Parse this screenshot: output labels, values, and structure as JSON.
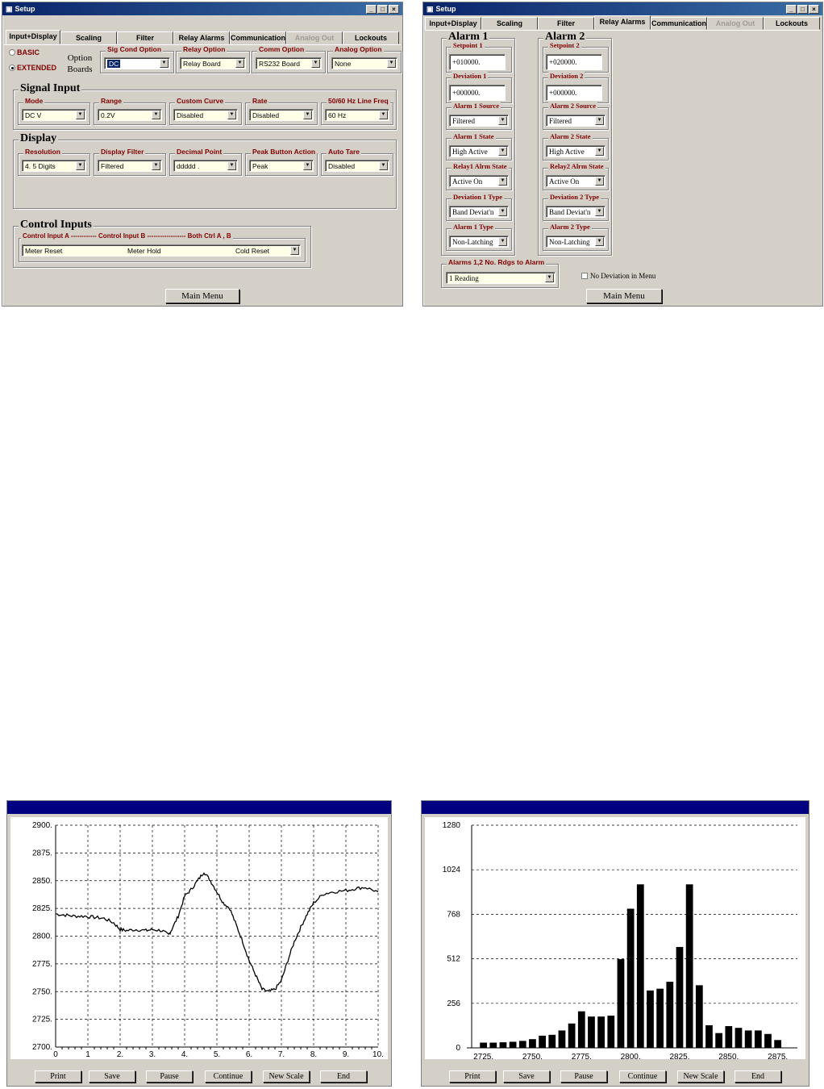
{
  "win1": {
    "title": "Setup",
    "tabs": [
      "Input+Display",
      "Scaling",
      "Filter",
      "Relay Alarms",
      "Communication",
      "Analog Out",
      "Lockouts"
    ],
    "active_tab": "Input+Display",
    "radio_basic": "BASIC",
    "radio_extended": "EXTENDED",
    "option_boards_label": "Option Boards",
    "option_boards": [
      {
        "label": "Sig Cond Option",
        "value": "DC"
      },
      {
        "label": "Relay Option",
        "value": "Relay Board"
      },
      {
        "label": "Comm Option",
        "value": "RS232 Board"
      },
      {
        "label": "Analog Option",
        "value": "None"
      }
    ],
    "signal_input_title": "Signal Input",
    "signal_input": [
      {
        "label": "Mode",
        "value": "DC V"
      },
      {
        "label": "Range",
        "value": "0.2V"
      },
      {
        "label": "Custom Curve",
        "value": "Disabled"
      },
      {
        "label": "Rate",
        "value": "Disabled"
      },
      {
        "label": "50/60 Hz Line Freq",
        "value": "60 Hz"
      }
    ],
    "display_title": "Display",
    "display": [
      {
        "label": "Resolution",
        "value": "4. 5 Digits"
      },
      {
        "label": "Display Filter",
        "value": "Filtered"
      },
      {
        "label": "Decimal Point",
        "value": "ddddd ."
      },
      {
        "label": "Peak Button Action",
        "value": "Peak"
      },
      {
        "label": "Auto Tare",
        "value": "Disabled"
      }
    ],
    "control_inputs_title": "Control Inputs",
    "control_header": "Control Input A ------------ Control Input B ------------------ Both Ctrl A , B",
    "control_values": [
      "Meter Reset",
      "Meter Hold",
      "Cold Reset"
    ],
    "main_menu": "Main Menu"
  },
  "win2": {
    "title": "Setup",
    "tabs": [
      "Input+Display",
      "Scaling",
      "Filter",
      "Relay Alarms",
      "Communication",
      "Analog Out",
      "Lockouts"
    ],
    "active_tab": "Relay Alarms",
    "alarm1": {
      "title": "Alarm 1",
      "fields": [
        {
          "label": "Setpoint 1",
          "value": "+010000.",
          "kind": "text"
        },
        {
          "label": "Deviation 1",
          "value": "+000000.",
          "kind": "text"
        },
        {
          "label": "Alarm 1 Source",
          "value": "Filtered",
          "kind": "combo"
        },
        {
          "label": "Alarm 1 State",
          "value": "High Active",
          "kind": "combo"
        },
        {
          "label": "Relay1 Alrm State",
          "value": "Active On",
          "kind": "combo"
        },
        {
          "label": "Deviation 1 Type",
          "value": "Band Deviat'n",
          "kind": "combo"
        },
        {
          "label": "Alarm 1 Type",
          "value": "Non-Latching",
          "kind": "combo"
        }
      ]
    },
    "alarm2": {
      "title": "Alarm 2",
      "fields": [
        {
          "label": "Setpoint 2",
          "value": "+020000.",
          "kind": "text"
        },
        {
          "label": "Deviation 2",
          "value": "+000000.",
          "kind": "text"
        },
        {
          "label": "Alarm 2 Source",
          "value": "Filtered",
          "kind": "combo"
        },
        {
          "label": "Alarm 2 State",
          "value": "High Active",
          "kind": "combo"
        },
        {
          "label": "Relay2 Alrm State",
          "value": "Active On",
          "kind": "combo"
        },
        {
          "label": "Deviation 2 Type",
          "value": "Band Deviat'n",
          "kind": "combo"
        },
        {
          "label": "Alarm 2 Type",
          "value": "Non-Latching",
          "kind": "combo"
        }
      ]
    },
    "rdgs_label": "Alarms 1,2  No. Rdgs to Alarm",
    "rdgs_value": "1 Reading",
    "no_dev_label": "No Deviation in Menu",
    "main_menu": "Main Menu"
  },
  "chart_buttons": [
    "Print",
    "Save",
    "Pause",
    "Continue",
    "New Scale",
    "End"
  ],
  "chart_data": [
    {
      "type": "line",
      "xlim": [
        0,
        10
      ],
      "ylim": [
        2700,
        2900
      ],
      "x_ticks": [
        "0",
        "1",
        "2.",
        "3.",
        "4.",
        "5.",
        "6.",
        "7.",
        "8.",
        "9.",
        "10."
      ],
      "y_ticks": [
        "2700.",
        "2725.",
        "2750.",
        "2775.",
        "2800.",
        "2825.",
        "2850.",
        "2875.",
        "2900."
      ],
      "grid": true,
      "x": [
        0,
        0.3,
        0.6,
        0.9,
        1.2,
        1.5,
        1.8,
        2.0,
        2.2,
        2.5,
        2.8,
        3.0,
        3.3,
        3.5,
        3.6,
        3.8,
        4.0,
        4.2,
        4.4,
        4.6,
        4.8,
        5.0,
        5.2,
        5.4,
        5.6,
        5.8,
        6.0,
        6.2,
        6.4,
        6.6,
        6.8,
        7.0,
        7.2,
        7.4,
        7.6,
        7.8,
        8.0,
        8.3,
        8.6,
        9.0,
        9.3,
        9.6,
        10.0
      ],
      "y": [
        2820,
        2819,
        2818,
        2818,
        2817,
        2816,
        2812,
        2806,
        2805,
        2806,
        2805,
        2806,
        2805,
        2801,
        2806,
        2818,
        2836,
        2842,
        2850,
        2858,
        2850,
        2840,
        2830,
        2825,
        2810,
        2795,
        2778,
        2765,
        2752,
        2750,
        2752,
        2760,
        2778,
        2795,
        2808,
        2820,
        2830,
        2838,
        2840,
        2841,
        2843,
        2844,
        2840
      ]
    },
    {
      "type": "bar",
      "ylim": [
        0,
        1280
      ],
      "y_ticks": [
        "0",
        "256",
        "512",
        "768",
        "1024",
        "1280"
      ],
      "x_ticks": [
        "2725.",
        "2750.",
        "2775.",
        "2800.",
        "2825.",
        "2850.",
        "2875."
      ],
      "xlim": [
        2719,
        2885
      ],
      "grid": true,
      "x": [
        2725,
        2730,
        2735,
        2740,
        2745,
        2750,
        2755,
        2760,
        2765,
        2770,
        2775,
        2780,
        2785,
        2790,
        2795,
        2800,
        2805,
        2810,
        2815,
        2820,
        2825,
        2830,
        2835,
        2840,
        2845,
        2850,
        2855,
        2860,
        2865,
        2870,
        2875
      ],
      "values": [
        30,
        30,
        32,
        35,
        40,
        50,
        70,
        75,
        100,
        140,
        210,
        180,
        180,
        185,
        510,
        800,
        940,
        330,
        340,
        380,
        580,
        940,
        360,
        130,
        85,
        125,
        115,
        100,
        100,
        80,
        45
      ]
    }
  ]
}
